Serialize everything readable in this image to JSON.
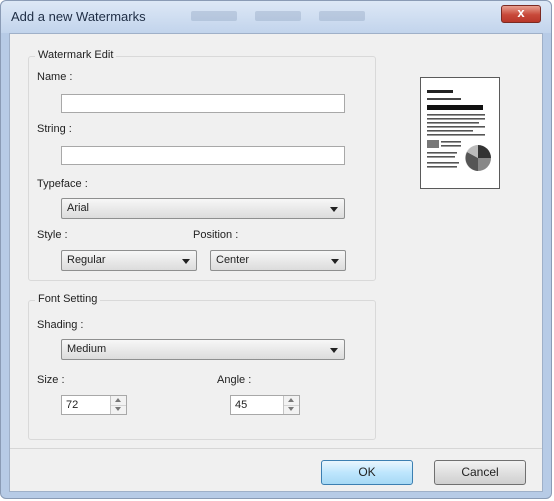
{
  "window": {
    "title": "Add a new Watermarks",
    "close_label": "x"
  },
  "watermark_edit": {
    "caption": "Watermark Edit",
    "name_label": "Name :",
    "name_value": "",
    "string_label": "String :",
    "string_value": "",
    "typeface_label": "Typeface :",
    "typeface_value": "Arial",
    "style_label": "Style :",
    "style_value": "Regular",
    "position_label": "Position :",
    "position_value": "Center"
  },
  "font_setting": {
    "caption": "Font Setting",
    "shading_label": "Shading :",
    "shading_value": "Medium",
    "size_label": "Size :",
    "size_value": "72",
    "angle_label": "Angle :",
    "angle_value": "45"
  },
  "buttons": {
    "ok": "OK",
    "cancel": "Cancel"
  },
  "colors": {
    "title_bar": "#c2d4ec",
    "close_button": "#c8493a",
    "ok_button": "#bee6fd",
    "dialog_bg": "#f0f0f0"
  }
}
